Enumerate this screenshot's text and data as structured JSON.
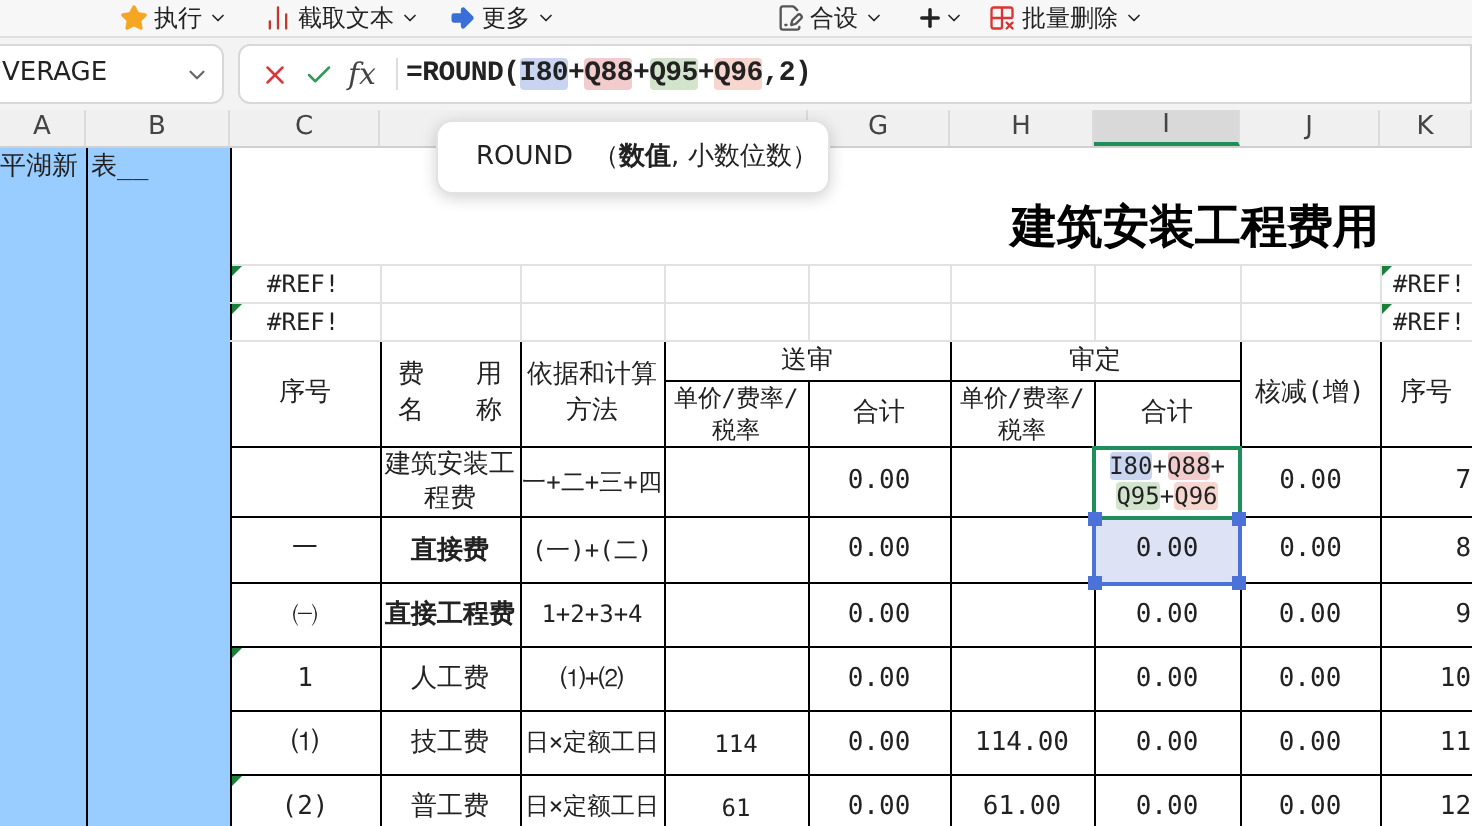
{
  "toolbar": {
    "items": [
      "执行",
      "截取文本",
      "更多",
      "合设",
      "批量删除"
    ]
  },
  "name_box": "VERAGE",
  "function_button": "fx",
  "formula": [
    {
      "text": "=ROUND("
    },
    {
      "text": "I80",
      "color": "#c9d5f0"
    },
    {
      "text": "+"
    },
    {
      "text": "Q88",
      "color": "#f2cccc"
    },
    {
      "text": "+"
    },
    {
      "text": "Q95",
      "color": "#d3e4cd"
    },
    {
      "text": "+"
    },
    {
      "text": "Q96",
      "color": "#f6d6cf"
    },
    {
      "text": ",2)"
    }
  ],
  "columns": [
    {
      "label": "A",
      "selected": false
    },
    {
      "label": "B",
      "selected": false
    },
    {
      "label": "C",
      "selected": false
    },
    {
      "label": "G",
      "selected": false
    },
    {
      "label": "H",
      "selected": false
    },
    {
      "label": "I",
      "selected": true
    },
    {
      "label": "J",
      "selected": false
    },
    {
      "label": "K",
      "selected": false
    }
  ],
  "tooltip": {
    "function": "ROUND",
    "args": "（**数值**, 小数位数）"
  },
  "sheet": {
    "row1": {
      "a": "平湖新",
      "b": "表__"
    },
    "title": "建筑安装工程费用",
    "ref_rows": [
      {
        "c": "#REF!",
        "k": "#REF!",
        "flagged": true
      },
      {
        "c": "#REF!",
        "k": "#REF!",
        "flagged": true
      }
    ],
    "header": {
      "seq": "序号",
      "name_lines": [
        "费　　用",
        "名　　称"
      ],
      "basis": "依据和计算方法",
      "groups": [
        {
          "label": "送审",
          "price": "单价/费率/税率",
          "total": "合计"
        },
        {
          "label": "审定",
          "price": "单价/费率/税率",
          "total": "合计"
        }
      ],
      "diff": "核减(增)",
      "seq2": "序号"
    },
    "rows": [
      {
        "seq": "",
        "name": "建筑安装工程费",
        "name_bold": false,
        "basis": "一+二+三+四",
        "s_price": "",
        "s_total": "0.00",
        "d_price": "",
        "d_total": "",
        "d_tokens": [
          {
            "text": "I80",
            "color": "#c9d5f0"
          },
          {
            "text": "+"
          },
          {
            "text": "Q88",
            "color": "#f2cccc"
          },
          {
            "text": "+"
          },
          {
            "text": "Q95",
            "color": "#d3e4cd"
          },
          {
            "text": "+"
          },
          {
            "text": "Q96",
            "color": "#f6d6cf"
          }
        ],
        "diff": "0.00",
        "k": "7",
        "flagged": false,
        "editing": true,
        "referenced": false
      },
      {
        "seq": "一",
        "name": "直接费",
        "name_bold": true,
        "basis": "(一)+(二)",
        "s_price": "",
        "s_total": "0.00",
        "d_price": "",
        "d_total": "0.00",
        "diff": "0.00",
        "k": "8",
        "flagged": false,
        "editing": false,
        "referenced": true
      },
      {
        "seq": "㈠",
        "name": "直接工程费",
        "name_bold": true,
        "basis": "1+2+3+4",
        "s_price": "",
        "s_total": "0.00",
        "d_price": "",
        "d_total": "0.00",
        "diff": "0.00",
        "k": "9",
        "flagged": false,
        "editing": false,
        "referenced": false
      },
      {
        "seq": "1",
        "name": "人工费",
        "name_bold": false,
        "basis": "⑴+⑵",
        "s_price": "",
        "s_total": "0.00",
        "d_price": "",
        "d_total": "0.00",
        "diff": "0.00",
        "k": "10",
        "flagged": true,
        "editing": false,
        "referenced": false
      },
      {
        "seq": "⑴",
        "name": "技工费",
        "name_bold": false,
        "basis": "日×定额工日",
        "s_price": "114",
        "s_total": "0.00",
        "d_price": "114.00",
        "d_total": "0.00",
        "diff": "0.00",
        "k": "11",
        "flagged": false,
        "editing": false,
        "referenced": false
      },
      {
        "seq": "(2)",
        "name": "普工费",
        "name_bold": false,
        "basis": "日×定额工日",
        "s_price": "61",
        "s_total": "0.00",
        "d_price": "61.00",
        "d_total": "0.00",
        "diff": "0.00",
        "k": "12",
        "flagged": true,
        "editing": false,
        "referenced": false
      }
    ]
  }
}
